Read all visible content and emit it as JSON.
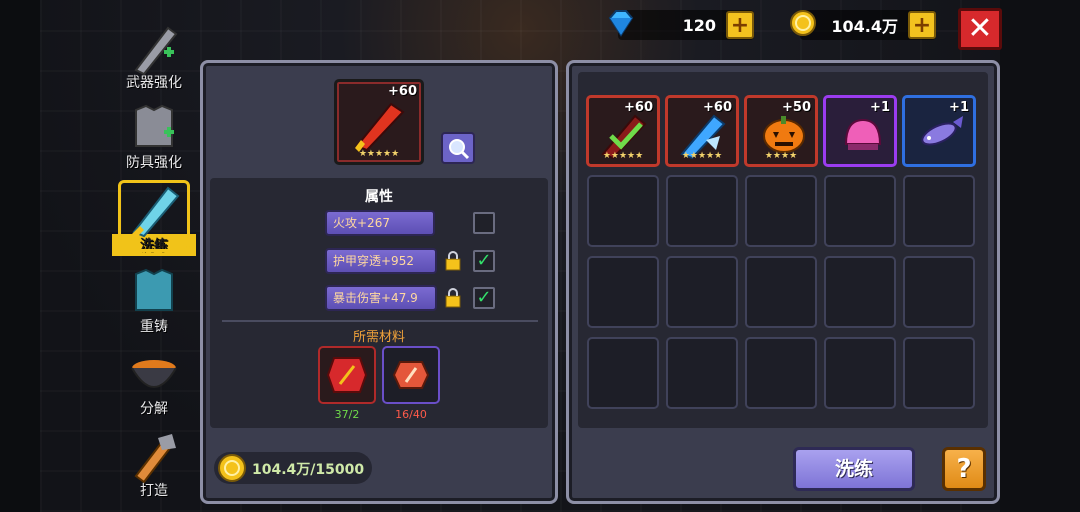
{
  "colors": {
    "accent": "#f1c319",
    "panel": "#3b3d4e",
    "text_ok": "#6fdb4a",
    "text_warn": "#ff5a4a"
  },
  "currency": {
    "gems": {
      "icon": "diamond-icon",
      "value": "120"
    },
    "coins": {
      "icon": "coin-icon",
      "value": "104.4万"
    }
  },
  "nav": [
    {
      "label": "武器强化",
      "icon": "sword-upgrade-icon"
    },
    {
      "label": "防具强化",
      "icon": "armor-upgrade-icon"
    },
    {
      "label": "洗练",
      "icon": "refine-sword-icon",
      "active": true
    },
    {
      "label": "重铸",
      "icon": "recast-armor-icon"
    },
    {
      "label": "分解",
      "icon": "cauldron-icon"
    },
    {
      "label": "打造",
      "icon": "forge-icon"
    }
  ],
  "selected_item": {
    "level": "+60",
    "stars": "★★★★★",
    "icon": "fire-sword-icon"
  },
  "attributes": {
    "title": "属性",
    "rows": [
      {
        "text": "火攻+267",
        "locked": false,
        "checked": false
      },
      {
        "text": "护甲穿透+952",
        "locked": true,
        "checked": true
      },
      {
        "text": "暴击伤害+47.9",
        "locked": true,
        "checked": true
      }
    ]
  },
  "materials": {
    "title": "所需材料",
    "items": [
      {
        "icon": "red-gem-material-icon",
        "count": "37/2",
        "status": "ok"
      },
      {
        "icon": "orange-stone-material-icon",
        "count": "16/40",
        "status": "short"
      }
    ]
  },
  "cost": {
    "text": "104.4万/15000",
    "icon": "coin-icon"
  },
  "inventory": [
    {
      "level": "+60",
      "stars": "★★★★★",
      "icon": "fire-sword-icon",
      "border": "#c0392b",
      "equipped": true
    },
    {
      "level": "+60",
      "stars": "★★★★★",
      "icon": "ice-blade-icon",
      "border": "#c0392b"
    },
    {
      "level": "+50",
      "stars": "★★★★",
      "icon": "pumpkin-icon",
      "border": "#c0392b"
    },
    {
      "level": "+1",
      "stars": "",
      "icon": "pink-slime-icon",
      "border": "#9b3cf0"
    },
    {
      "level": "+1",
      "stars": "",
      "icon": "fish-weapon-icon",
      "border": "#2f6fe0"
    }
  ],
  "buttons": {
    "refine": "洗练",
    "help": "?",
    "close": "✕",
    "plus": "+"
  }
}
